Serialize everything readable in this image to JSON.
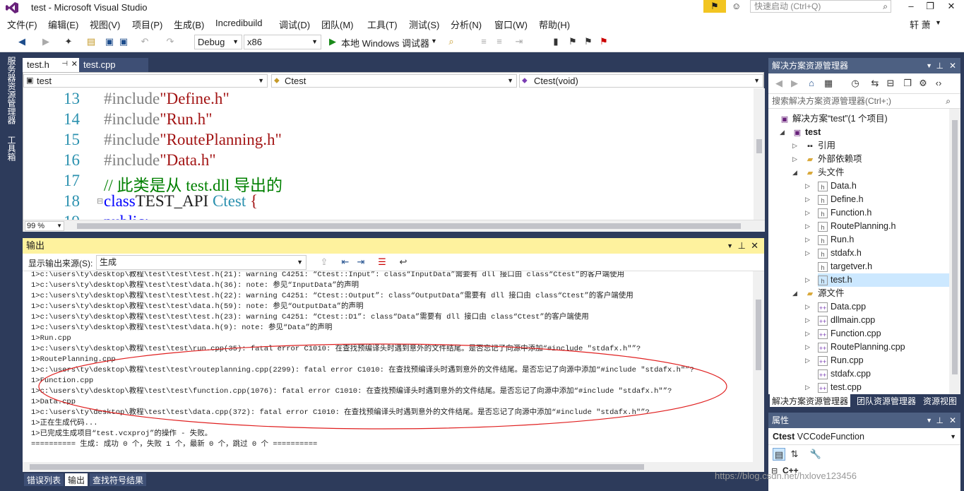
{
  "titlebar": {
    "title": "test - Microsoft Visual Studio",
    "quick_launch_placeholder": "快速启动 (Ctrl+Q)"
  },
  "menu": [
    "文件(F)",
    "编辑(E)",
    "视图(V)",
    "项目(P)",
    "生成(B)",
    "Incredibuild",
    "调试(D)",
    "团队(M)",
    "工具(T)",
    "测试(S)",
    "分析(N)",
    "窗口(W)",
    "帮助(H)"
  ],
  "user": "轩 萧",
  "toolbar": {
    "config": "Debug",
    "platform": "x86",
    "run_label": "本地 Windows 调试器"
  },
  "left_tabs": [
    "服务器资源管理器",
    "工具箱"
  ],
  "doc_tabs": [
    {
      "label": "test.h",
      "active": true
    },
    {
      "label": "test.cpp",
      "active": false
    }
  ],
  "navbar": {
    "project": "test",
    "class": "Ctest",
    "member": "Ctest(void)"
  },
  "code_lines": [
    {
      "n": "13",
      "parts": [
        [
          "pp",
          "#include"
        ],
        [
          "str",
          "\"Define.h\""
        ]
      ]
    },
    {
      "n": "14",
      "parts": [
        [
          "pp",
          "#include"
        ],
        [
          "str",
          "\"Run.h\""
        ]
      ]
    },
    {
      "n": "15",
      "parts": [
        [
          "pp",
          "#include"
        ],
        [
          "str",
          "\"RoutePlanning.h\""
        ]
      ]
    },
    {
      "n": "16",
      "parts": [
        [
          "pp",
          "#include"
        ],
        [
          "str",
          "\"Data.h\""
        ]
      ]
    },
    {
      "n": "17",
      "parts": [
        [
          "cm",
          "// 此类是从 test.dll 导出的"
        ]
      ]
    },
    {
      "n": "18",
      "parts": [
        [
          "kw",
          "class"
        ],
        [
          "",
          "TEST_API "
        ],
        [
          "ty",
          "Ctest"
        ],
        [
          "str",
          " {"
        ]
      ]
    },
    {
      "n": "19",
      "parts": [
        [
          "kw",
          "public:"
        ]
      ]
    }
  ],
  "zoom": "99 %",
  "output": {
    "title": "输出",
    "source_label": "显示输出来源(S):",
    "source_value": "生成",
    "lines": [
      "1>c:\\users\\ty\\desktop\\教程\\test\\test\\test.h(21): warning C4251: “Ctest::Input”: class“InputData”需要有 dll 接口由 class“Ctest”的客户端使用",
      "1>c:\\users\\ty\\desktop\\教程\\test\\test\\data.h(36): note: 参见“InputData”的声明",
      "1>c:\\users\\ty\\desktop\\教程\\test\\test\\test.h(22): warning C4251: “Ctest::Output”: class“OutputData”需要有 dll 接口由 class“Ctest”的客户端使用",
      "1>c:\\users\\ty\\desktop\\教程\\test\\test\\data.h(59): note: 参见“OutputData”的声明",
      "1>c:\\users\\ty\\desktop\\教程\\test\\test\\test.h(23): warning C4251: “Ctest::D1”: class“Data”需要有 dll 接口由 class“Ctest”的客户端使用",
      "1>c:\\users\\ty\\desktop\\教程\\test\\test\\data.h(9): note: 参见“Data”的声明",
      "1>Run.cpp",
      "1>c:\\users\\ty\\desktop\\教程\\test\\test\\run.cpp(35): fatal error C1010: 在查找预编译头时遇到意外的文件结尾。是否忘记了向源中添加“#include \"stdafx.h\"”?",
      "1>RoutePlanning.cpp",
      "1>c:\\users\\ty\\desktop\\教程\\test\\test\\routeplanning.cpp(2299): fatal error C1010: 在查找预编译头时遇到意外的文件结尾。是否忘记了向源中添加“#include \"stdafx.h\"”?",
      "1>Function.cpp",
      "1>c:\\users\\ty\\desktop\\教程\\test\\test\\function.cpp(1076): fatal error C1010: 在查找预编译头时遇到意外的文件结尾。是否忘记了向源中添加“#include \"stdafx.h\"”?",
      "1>Data.cpp",
      "1>c:\\users\\ty\\desktop\\教程\\test\\test\\data.cpp(372): fatal error C1010: 在查找预编译头时遇到意外的文件结尾。是否忘记了向源中添加“#include \"stdafx.h\"”?",
      "1>正在生成代码...",
      "1>已完成生成项目“test.vcxproj”的操作 - 失败。",
      "========== 生成: 成功 0 个，失败 1 个，最新 0 个，跳过 0 个 =========="
    ]
  },
  "bottom_tabs": [
    {
      "label": "错误列表",
      "active": false
    },
    {
      "label": "输出",
      "active": true
    },
    {
      "label": "查找符号结果",
      "active": false
    }
  ],
  "solution_explorer": {
    "title": "解决方案资源管理器",
    "search_placeholder": "搜索解决方案资源管理器(Ctrl+;)",
    "nodes": [
      {
        "label": "解决方案“test”(1 个项目)",
        "depth": 0,
        "twisty": "",
        "icon": "solution-icon",
        "bold": false
      },
      {
        "label": "test",
        "depth": 1,
        "twisty": "◢",
        "icon": "project-icon",
        "bold": true
      },
      {
        "label": "引用",
        "depth": 2,
        "twisty": "▷",
        "icon": "references-icon",
        "bold": false
      },
      {
        "label": "外部依赖项",
        "depth": 2,
        "twisty": "▷",
        "icon": "folder-icon",
        "bold": false
      },
      {
        "label": "头文件",
        "depth": 2,
        "twisty": "◢",
        "icon": "folder-icon",
        "bold": false
      },
      {
        "label": "Data.h",
        "depth": 3,
        "twisty": "▷",
        "icon": "header-file-icon",
        "bold": false
      },
      {
        "label": "Define.h",
        "depth": 3,
        "twisty": "▷",
        "icon": "header-file-icon",
        "bold": false
      },
      {
        "label": "Function.h",
        "depth": 3,
        "twisty": "▷",
        "icon": "header-file-icon",
        "bold": false
      },
      {
        "label": "RoutePlanning.h",
        "depth": 3,
        "twisty": "▷",
        "icon": "header-file-icon",
        "bold": false
      },
      {
        "label": "Run.h",
        "depth": 3,
        "twisty": "▷",
        "icon": "header-file-icon",
        "bold": false
      },
      {
        "label": "stdafx.h",
        "depth": 3,
        "twisty": "▷",
        "icon": "header-file-icon",
        "bold": false
      },
      {
        "label": "targetver.h",
        "depth": 3,
        "twisty": "",
        "icon": "header-file-icon",
        "bold": false
      },
      {
        "label": "test.h",
        "depth": 3,
        "twisty": "▷",
        "icon": "header-file-icon",
        "bold": false,
        "selected": true
      },
      {
        "label": "源文件",
        "depth": 2,
        "twisty": "◢",
        "icon": "folder-icon",
        "bold": false
      },
      {
        "label": "Data.cpp",
        "depth": 3,
        "twisty": "▷",
        "icon": "cpp-file-icon",
        "bold": false
      },
      {
        "label": "dllmain.cpp",
        "depth": 3,
        "twisty": "▷",
        "icon": "cpp-file-icon",
        "bold": false
      },
      {
        "label": "Function.cpp",
        "depth": 3,
        "twisty": "▷",
        "icon": "cpp-file-icon",
        "bold": false
      },
      {
        "label": "RoutePlanning.cpp",
        "depth": 3,
        "twisty": "▷",
        "icon": "cpp-file-icon",
        "bold": false
      },
      {
        "label": "Run.cpp",
        "depth": 3,
        "twisty": "▷",
        "icon": "cpp-file-icon",
        "bold": false
      },
      {
        "label": "stdafx.cpp",
        "depth": 3,
        "twisty": "",
        "icon": "cpp-file-icon",
        "bold": false
      },
      {
        "label": "test.cpp",
        "depth": 3,
        "twisty": "▷",
        "icon": "cpp-file-icon",
        "bold": false
      }
    ],
    "tabs": [
      {
        "label": "解决方案资源管理器",
        "active": true
      },
      {
        "label": "团队资源管理器",
        "active": false
      },
      {
        "label": "资源视图",
        "active": false
      }
    ]
  },
  "properties": {
    "title": "属性",
    "object_bold": "Ctest",
    "object_type": "VCCodeFunction",
    "category": "C++"
  },
  "watermark": "https://blog.csdn.net/hxlove123456",
  "colors": {
    "accent": "#2d3b5b",
    "output_header": "#fef29e",
    "selection": "#cce8ff",
    "annotation_ellipse": "#e02020"
  }
}
